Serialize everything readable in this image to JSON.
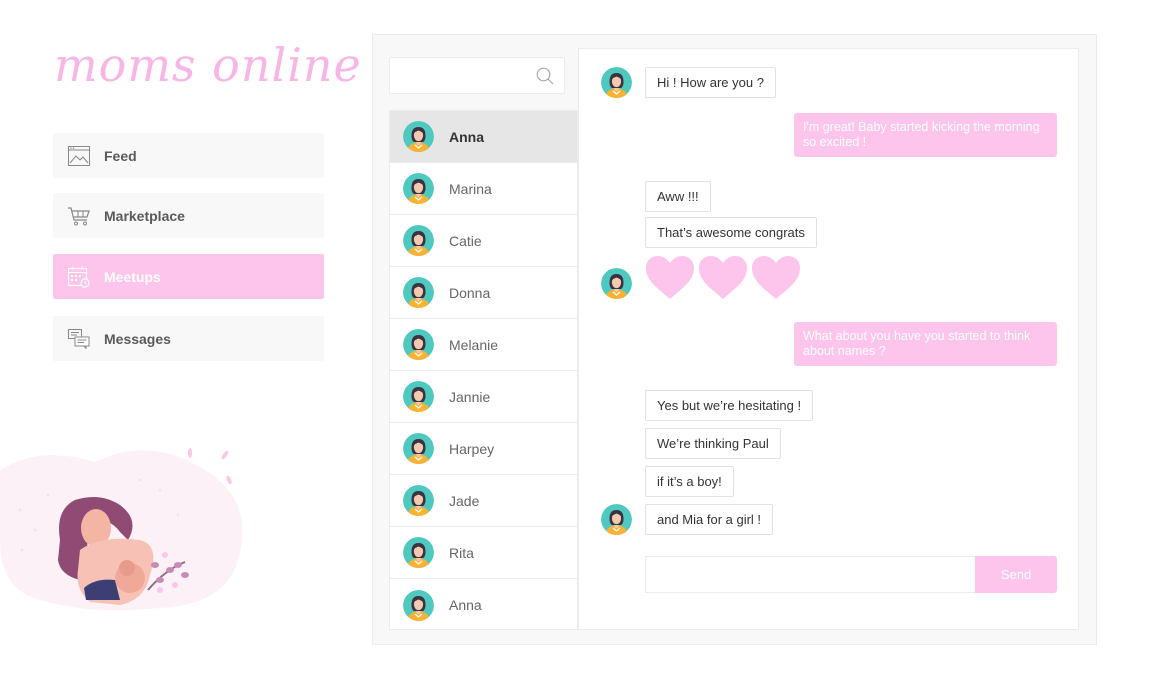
{
  "app": {
    "logo": "moms online"
  },
  "sidebar": {
    "items": [
      {
        "label": "Feed",
        "icon": "image-icon"
      },
      {
        "label": "Marketplace",
        "icon": "cart-icon"
      },
      {
        "label": "Meetups",
        "icon": "calendar-icon",
        "active": true
      },
      {
        "label": "Messages",
        "icon": "messages-icon"
      }
    ]
  },
  "search": {
    "placeholder": ""
  },
  "contacts": [
    "Anna",
    "Marina",
    "Catie",
    "Donna",
    "Melanie",
    "Jannie",
    "Harpey",
    "Jade",
    "Rita",
    "Anna"
  ],
  "selected_contact": "Anna",
  "messages": [
    {
      "from": "them",
      "text": "Hi ! How are you ?"
    },
    {
      "from": "me",
      "text": "I'm great! Baby started kicking the morning so excited !"
    },
    {
      "from": "them",
      "text": "Aww !!!"
    },
    {
      "from": "them",
      "text": "That’s awesome congrats"
    },
    {
      "from": "them",
      "type": "hearts",
      "count": 3
    },
    {
      "from": "me",
      "text": "What about you have you started to think about names ?"
    },
    {
      "from": "them",
      "text": "Yes but we’re hesitating !"
    },
    {
      "from": "them",
      "text": "We’re thinking Paul"
    },
    {
      "from": "them",
      "text": "if it’s a boy!"
    },
    {
      "from": "them",
      "text": "and Mia for a girl !"
    }
  ],
  "composer": {
    "placeholder": "",
    "send_label": "Send"
  },
  "colors": {
    "accent": "#fdc4ec",
    "panel": "#f8f8f8",
    "avatar_bg": "#4fc9c0",
    "avatar_shirt": "#f9b233"
  }
}
